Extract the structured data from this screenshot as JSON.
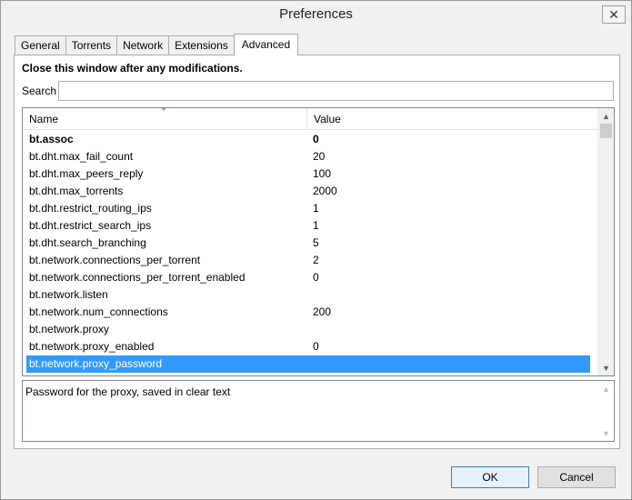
{
  "window": {
    "title": "Preferences",
    "close_glyph": "✕"
  },
  "tabs": [
    {
      "label": "General",
      "active": false
    },
    {
      "label": "Torrents",
      "active": false
    },
    {
      "label": "Network",
      "active": false
    },
    {
      "label": "Extensions",
      "active": false
    },
    {
      "label": "Advanced",
      "active": true
    }
  ],
  "advanced": {
    "notice": "Close this window after any modifications.",
    "search": {
      "label": "Search",
      "value": "",
      "placeholder": ""
    },
    "list": {
      "columns": {
        "name": "Name",
        "value": "Value"
      },
      "rows": [
        {
          "name": "bt.assoc",
          "value": "0",
          "bold": true
        },
        {
          "name": "bt.dht.max_fail_count",
          "value": "20"
        },
        {
          "name": "bt.dht.max_peers_reply",
          "value": "100"
        },
        {
          "name": "bt.dht.max_torrents",
          "value": "2000"
        },
        {
          "name": "bt.dht.restrict_routing_ips",
          "value": "1"
        },
        {
          "name": "bt.dht.restrict_search_ips",
          "value": "1"
        },
        {
          "name": "bt.dht.search_branching",
          "value": "5"
        },
        {
          "name": "bt.network.connections_per_torrent",
          "value": "2"
        },
        {
          "name": "bt.network.connections_per_torrent_enabled",
          "value": "0"
        },
        {
          "name": "bt.network.listen",
          "value": ""
        },
        {
          "name": "bt.network.num_connections",
          "value": "200"
        },
        {
          "name": "bt.network.proxy",
          "value": ""
        },
        {
          "name": "bt.network.proxy_enabled",
          "value": "0"
        },
        {
          "name": "bt.network.proxy_password",
          "value": "",
          "selected": true
        }
      ]
    },
    "description": "Password for the proxy, saved in clear text"
  },
  "buttons": {
    "ok": "OK",
    "cancel": "Cancel"
  },
  "icons": {
    "scroll_up": "▲",
    "scroll_down": "▼"
  },
  "colors": {
    "selection": "#3399ff",
    "default_button_border": "#3c7fb1"
  }
}
